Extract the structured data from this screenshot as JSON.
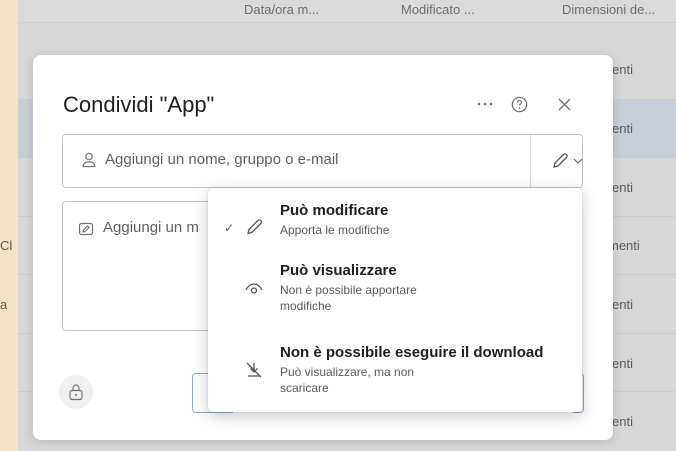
{
  "background": {
    "headers": [
      "Data/ora m...",
      "Modificato ...",
      "Dimensioni de..."
    ],
    "rows_right": [
      "enti",
      "enti",
      "enti",
      "menti",
      "enti",
      "enti",
      "enti"
    ],
    "rows_left": [
      "Cl",
      "a"
    ]
  },
  "dialog": {
    "title": "Condividi \"App\"",
    "more_icon": "ellipsis-icon",
    "help_icon": "help-icon",
    "close_icon": "close-icon",
    "add_field_placeholder": "Aggiungi un nome, gruppo o e-mail",
    "message_placeholder": "Aggiungi un m"
  },
  "permission_menu": {
    "items": [
      {
        "title": "Può modificare",
        "subtitle": [
          "Apporta le modifiche"
        ],
        "selected": true,
        "icon": "pencil-icon"
      },
      {
        "title": "Può visualizzare",
        "subtitle": [
          "Non è possibile apportare",
          "modifiche"
        ],
        "selected": false,
        "icon": "eye-icon"
      },
      {
        "title": "Non è possibile eseguire il download",
        "subtitle": [
          "Può visualizzare, ma non",
          "scaricare"
        ],
        "selected": false,
        "icon": "no-download-icon"
      }
    ],
    "check_mark": "✓"
  },
  "colors": {
    "accent": "#0f6cbd",
    "backdrop": "#f3e2c6"
  }
}
